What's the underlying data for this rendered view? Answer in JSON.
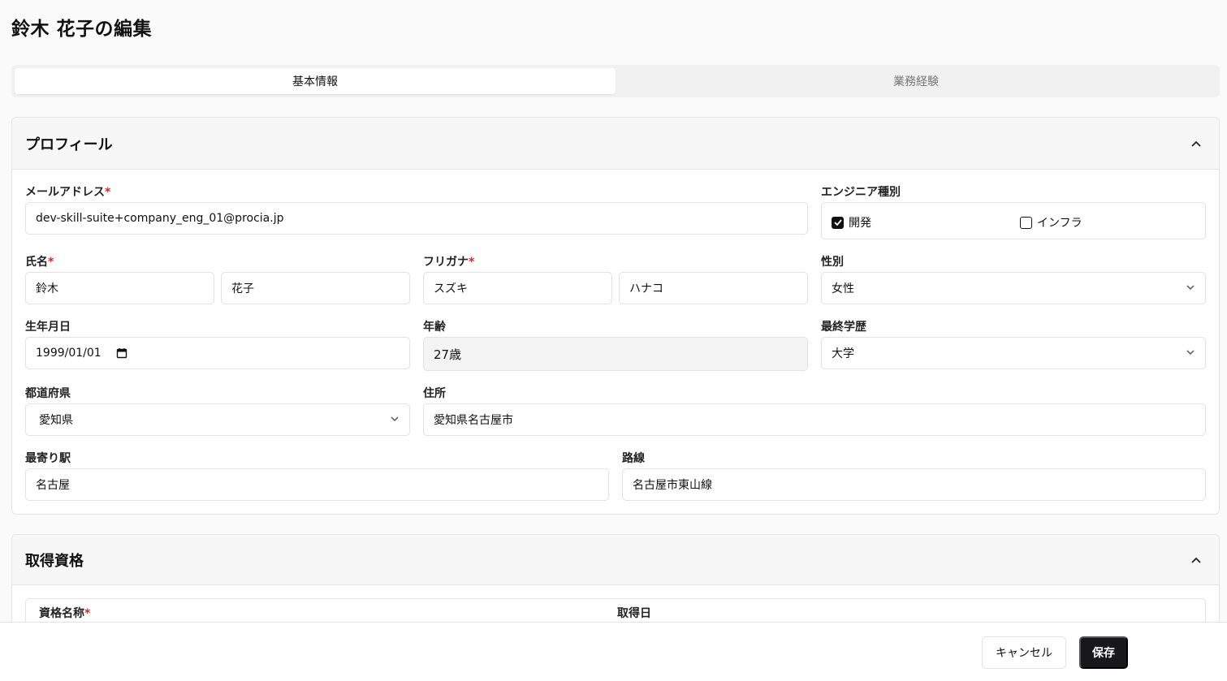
{
  "page": {
    "title": "鈴木 花子の編集"
  },
  "tabs": [
    {
      "label": "基本情報",
      "active": true
    },
    {
      "label": "業務経験",
      "active": false
    }
  ],
  "profile": {
    "title": "プロフィール",
    "email": {
      "label": "メールアドレス",
      "required": "*",
      "value": "dev-skill-suite+company_eng_01@procia.jp"
    },
    "engineer_type": {
      "label": "エンジニア種別",
      "options": [
        {
          "label": "開発",
          "checked": true
        },
        {
          "label": "インフラ",
          "checked": false
        }
      ]
    },
    "name": {
      "label": "氏名",
      "required": "*",
      "last": "鈴木",
      "first": "花子"
    },
    "furigana": {
      "label": "フリガナ",
      "required": "*",
      "last": "スズキ",
      "first": "ハナコ"
    },
    "gender": {
      "label": "性別",
      "value": "女性"
    },
    "birthdate": {
      "label": "生年月日",
      "value": "1999/01/01"
    },
    "age": {
      "label": "年齢",
      "value": "27歳"
    },
    "education": {
      "label": "最終学歴",
      "value": "大学"
    },
    "prefecture": {
      "label": "都道府県",
      "value": "愛知県"
    },
    "address": {
      "label": "住所",
      "value": "愛知県名古屋市"
    },
    "station": {
      "label": "最寄り駅",
      "value": "名古屋"
    },
    "line": {
      "label": "路線",
      "value": "名古屋市東山線"
    }
  },
  "qualifications": {
    "title": "取得資格",
    "name_label": "資格名称",
    "name_required": "*",
    "date_label": "取得日"
  },
  "footer": {
    "cancel_label": "キャンセル",
    "save_label": "保存"
  },
  "colors": {
    "accent": "#18181b",
    "required": "#dc2626",
    "border": "#e4e4e7"
  },
  "icons": {
    "collapse": "chevron-up-icon",
    "select": "chevron-down-icon",
    "calendar": "calendar-icon",
    "check": "check-icon"
  }
}
